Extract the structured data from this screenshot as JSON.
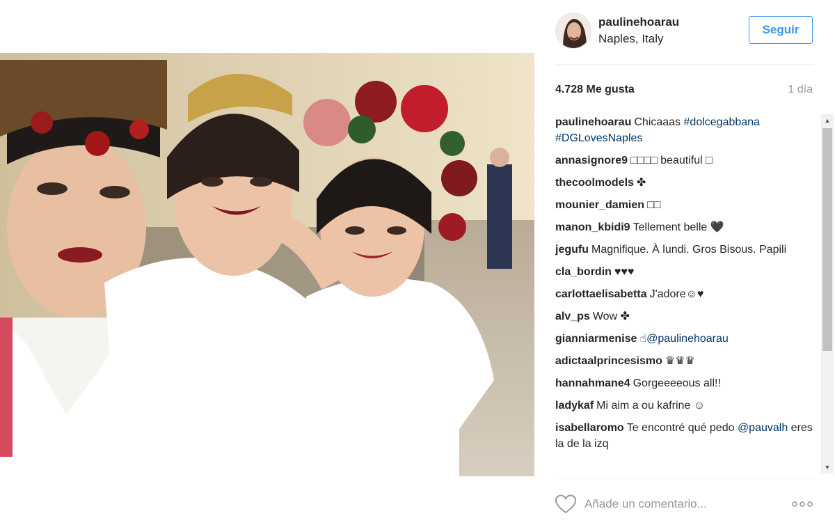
{
  "post": {
    "username": "paulinehoarau",
    "location": "Naples, Italy",
    "follow_label": "Seguir",
    "likes": "4.728 Me gusta",
    "time": "1 día",
    "comment_placeholder": "Añade un comentario..."
  },
  "comments": [
    {
      "user": "paulinehoarau",
      "parts": [
        {
          "t": "Chicaaas "
        },
        {
          "t": "#dolcegabbana",
          "tag": true
        },
        {
          "t": " "
        },
        {
          "t": "#DGLovesNaples",
          "tag": true
        }
      ]
    },
    {
      "user": "annasignore9",
      "parts": [
        {
          "t": "□□□□ beautiful □"
        }
      ]
    },
    {
      "user": "thecoolmodels",
      "parts": [
        {
          "t": "✤"
        }
      ]
    },
    {
      "user": "mounier_damien",
      "parts": [
        {
          "t": "□□"
        }
      ]
    },
    {
      "user": "manon_kbidi9",
      "parts": [
        {
          "t": "Tellement belle 🖤"
        }
      ]
    },
    {
      "user": "jegufu",
      "parts": [
        {
          "t": "Magnifique. À lundi. Gros Bisous. Papili"
        }
      ]
    },
    {
      "user": "cla_bordin",
      "parts": [
        {
          "t": "♥♥♥"
        }
      ]
    },
    {
      "user": "carlottaelisabetta",
      "parts": [
        {
          "t": "J'adore☺♥"
        }
      ]
    },
    {
      "user": "alv_ps",
      "parts": [
        {
          "t": "Wow ✤"
        }
      ]
    },
    {
      "user": "gianniarmenise",
      "parts": [
        {
          "t": "☝"
        },
        {
          "t": "@paulinehoarau",
          "tag": true
        }
      ]
    },
    {
      "user": "adictaalprincesismo",
      "parts": [
        {
          "t": "♛♛♛"
        }
      ]
    },
    {
      "user": "hannahmane4",
      "parts": [
        {
          "t": "Gorgeeeeous all!!"
        }
      ]
    },
    {
      "user": "ladykaf",
      "parts": [
        {
          "t": "Mi aim a ou kafrine ☺"
        }
      ]
    },
    {
      "user": "isabellaromo",
      "parts": [
        {
          "t": "Te encontré qué pedo "
        },
        {
          "t": "@pauvalh",
          "tag": true
        },
        {
          "t": " eres la de la izq"
        }
      ]
    }
  ],
  "colors": {
    "accent": "#3897f0",
    "hashtag": "#003569",
    "muted": "#999999"
  },
  "icons": {
    "like": "heart-outline-icon",
    "more": "ellipsis-icon"
  }
}
